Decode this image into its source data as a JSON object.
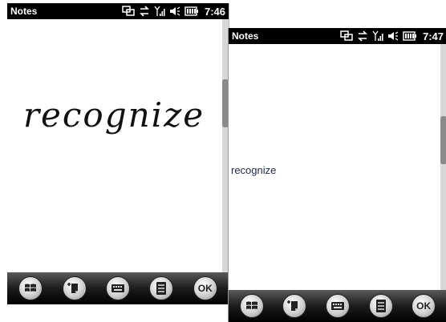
{
  "left_screen": {
    "app_title": "Notes",
    "time": "7:46",
    "ink_text": "recognize",
    "toolbar": {
      "ok_label": "OK"
    }
  },
  "right_screen": {
    "app_title": "Notes",
    "time": "7:47",
    "recognized_text": "recognize",
    "toolbar": {
      "ok_label": "OK"
    }
  },
  "icons": [
    "sync-icon",
    "data-transfer-icon",
    "signal-icon",
    "volume-icon",
    "battery-icon",
    "windows-start-icon",
    "new-note-icon",
    "keyboard-icon",
    "menu-icon"
  ]
}
